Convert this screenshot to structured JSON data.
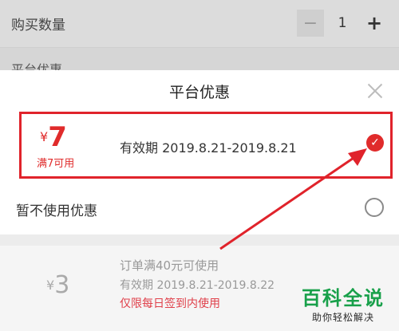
{
  "background": {
    "quantity_label": "购买数量",
    "quantity_value": "1",
    "minus_symbol": "−",
    "plus_symbol": "+",
    "partial_row_label": "平台优惠"
  },
  "sheet": {
    "title": "平台优惠",
    "selected_coupon": {
      "currency": "¥",
      "amount": "7",
      "condition": "满7可用",
      "validity": "有效期 2019.8.21-2019.8.21",
      "selected": true
    },
    "no_coupon_option": {
      "label": "暂不使用优惠",
      "selected": false
    },
    "disabled_coupon": {
      "currency": "¥",
      "amount": "3",
      "min_spend": "订单满40元可使用",
      "validity": "有效期 2019.8.21-2019.8.22",
      "note": "仅限每日签到内使用"
    }
  },
  "watermark": {
    "title": "百科全说",
    "subtitle": "助你轻松解决"
  },
  "colors": {
    "accent_red": "#e02b2b",
    "annotation_red": "#e0232b",
    "watermark_green": "#18a04a"
  },
  "icons": {
    "check": "checkmark-circle-icon",
    "close": "close-icon",
    "radio": "radio-empty-icon"
  }
}
